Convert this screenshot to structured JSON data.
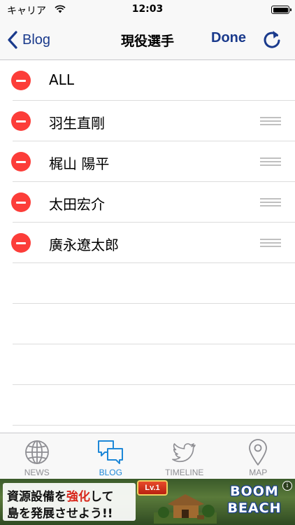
{
  "status_bar": {
    "carrier": "キャリア",
    "time": "12:03",
    "battery_level": 1.0
  },
  "nav": {
    "back_label": "Blog",
    "title": "現役選手",
    "done_label": "Done",
    "back_icon": "chevron-left-icon",
    "refresh_icon": "refresh-icon",
    "accent_color": "#1a3a8c"
  },
  "list": {
    "rows": [
      {
        "label": "ALL",
        "reorderable": false
      },
      {
        "label": "羽生直剛",
        "reorderable": true
      },
      {
        "label": "梶山 陽平",
        "reorderable": true
      },
      {
        "label": "太田宏介",
        "reorderable": true
      },
      {
        "label": "廣永遼太郎",
        "reorderable": true
      }
    ],
    "delete_color": "#fc3d39"
  },
  "tabs": [
    {
      "label": "NEWS",
      "icon": "globe-icon",
      "active": false
    },
    {
      "label": "BLOG",
      "icon": "chat-bubbles-icon",
      "active": true
    },
    {
      "label": "TIMELINE",
      "icon": "bird-icon",
      "active": false
    },
    {
      "label": "MAP",
      "icon": "map-pin-icon",
      "active": false
    }
  ],
  "tab_colors": {
    "active": "#1e88d8",
    "inactive": "#8e8e93"
  },
  "ad": {
    "line1_a": "資源設備を",
    "line1_b": "強化",
    "line1_c": "して",
    "line2": "島を発展させよう!!",
    "badge": "Lv.1",
    "logo_line1": "BOOM",
    "logo_line2": "BEACH",
    "info": "i"
  }
}
